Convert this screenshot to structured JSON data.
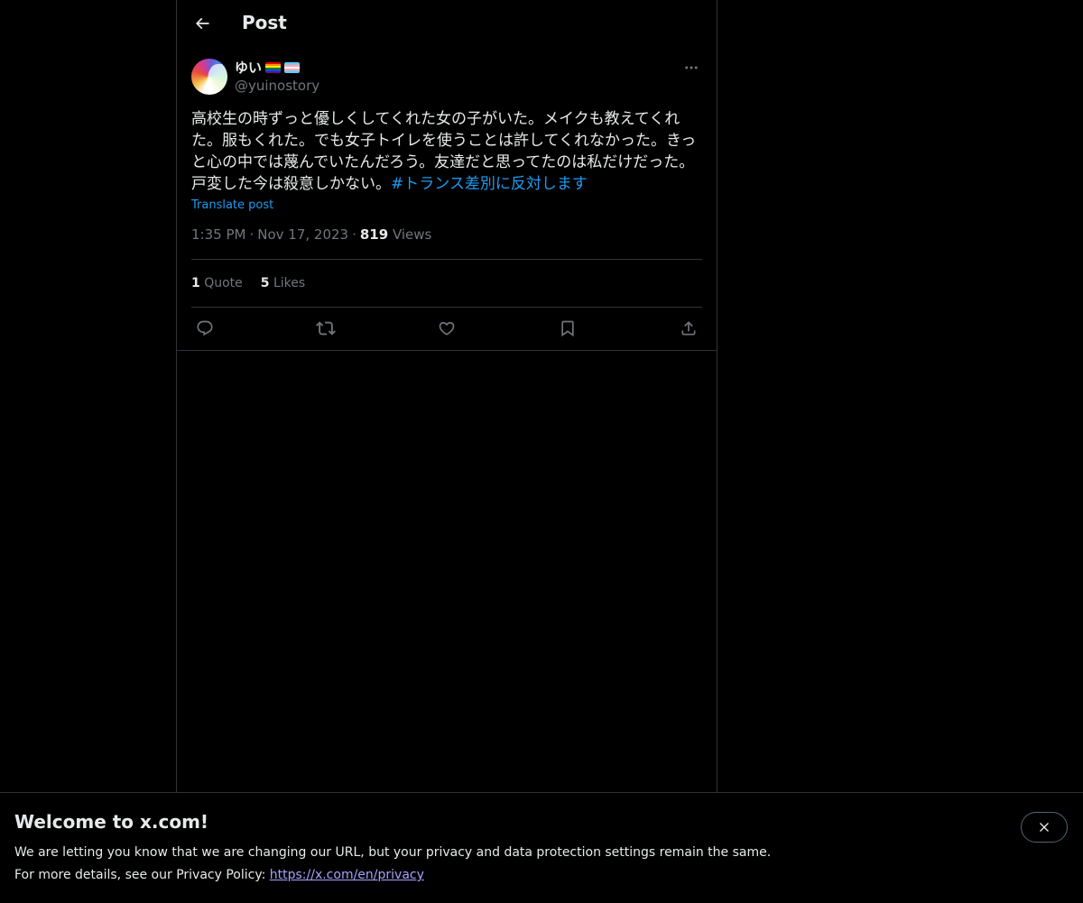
{
  "header": {
    "title": "Post"
  },
  "post": {
    "author": {
      "display_name": "ゆい",
      "handle": "@yuinostory",
      "name_badges": [
        "rainbow-flag",
        "transgender-flag"
      ]
    },
    "text": "高校生の時ずっと優しくしてくれた女の子がいた。メイクも教えてくれた。服もくれた。でも女子トイレを使うことは許してくれなかった。きっと心の中では蔑んでいたんだろう。友達だと思ってたのは私だけだった。戸変した今は殺意しかない。",
    "hashtag": "#トランス差別に反対します",
    "translate_label": "Translate post",
    "time": "1:35 PM",
    "date": "Nov 17, 2023",
    "separator": "·",
    "views_count": "819",
    "views_label": "Views",
    "stats": {
      "quotes_count": "1",
      "quotes_label": "Quote",
      "likes_count": "5",
      "likes_label": "Likes"
    },
    "actions": [
      "reply-icon",
      "repost-icon",
      "like-icon",
      "bookmark-icon",
      "share-icon"
    ]
  },
  "banner": {
    "title": "Welcome to x.com!",
    "line1": "We are letting you know that we are changing our URL, but your privacy and data protection settings remain the same.",
    "line2_prefix": "For more details, see our Privacy Policy: ",
    "link": "https://x.com/en/privacy"
  },
  "colors": {
    "background": "#000000",
    "text": "#e7e9ea",
    "muted": "#71767b",
    "accent": "#1d9bf0",
    "border": "#2f3336"
  }
}
